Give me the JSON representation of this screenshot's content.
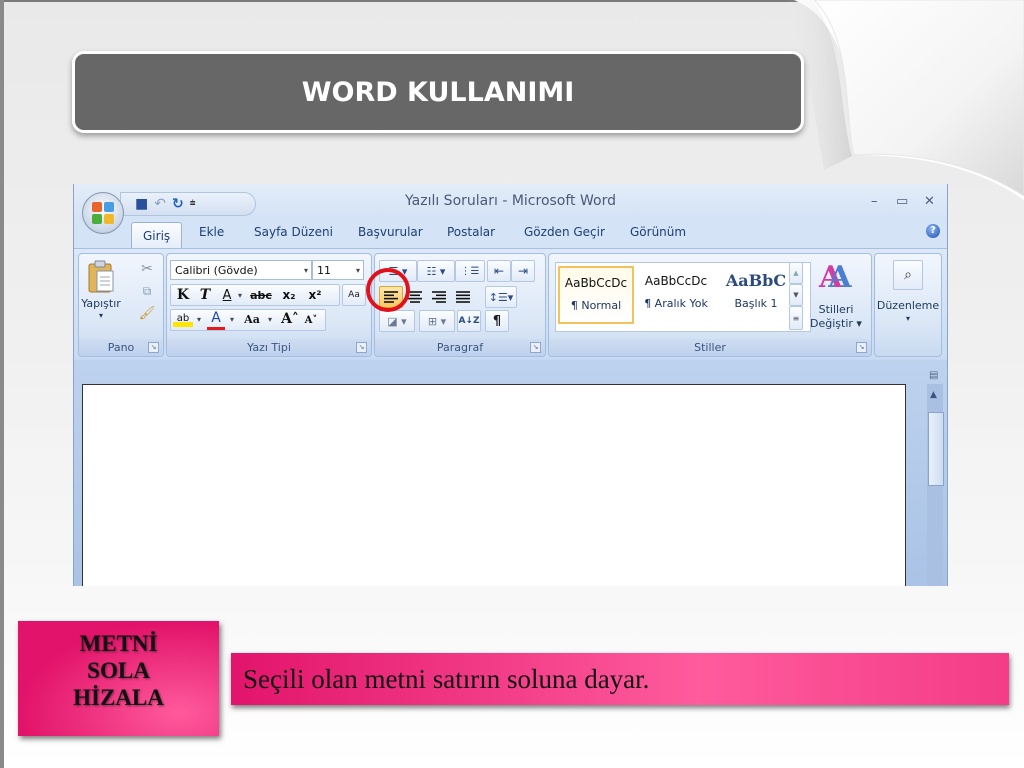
{
  "slide": {
    "title": "WORD KULLANIMI",
    "caption_label": [
      "METNİ",
      "SOLA",
      "HİZALA"
    ],
    "caption_text": "Seçili olan metni satırın soluna dayar."
  },
  "word": {
    "window_title": "Yazılı Soruları - Microsoft Word",
    "window_controls": {
      "minimize": "–",
      "maximize": "▭",
      "close": "✕"
    },
    "qat": {
      "save": "💾",
      "undo": "↶",
      "redo": "↻",
      "customize": "⩧"
    },
    "tabs": [
      {
        "label": "Giriş",
        "active": true
      },
      {
        "label": "Ekle"
      },
      {
        "label": "Sayfa Düzeni"
      },
      {
        "label": "Başvurular"
      },
      {
        "label": "Postalar"
      },
      {
        "label": "Gözden Geçir"
      },
      {
        "label": "Görünüm"
      }
    ],
    "help": "?",
    "groups": {
      "pano": {
        "label": "Pano",
        "paste_label": "Yapıştır",
        "paste_arrow": "▾"
      },
      "yazi_tipi": {
        "label": "Yazı Tipi",
        "font_name": "Calibri (Gövde)",
        "font_size": "11",
        "bold": "K",
        "italic": "T",
        "underline": "A",
        "strikethrough": "abc",
        "subscript": "x₂",
        "superscript": "x²",
        "clear_format": "Aa",
        "highlight": "ab",
        "font_color": "A",
        "change_case": "Aa",
        "grow_font": "A˄",
        "shrink_font": "A˅"
      },
      "paragraf": {
        "label": "Paragraf",
        "sort": "A↓Z",
        "show_marks": "¶",
        "selected_button": "align-left"
      },
      "stiller": {
        "label": "Stiller",
        "styles": [
          {
            "sample": "AaBbCcDc",
            "name": "¶ Normal",
            "selected": true
          },
          {
            "sample": "AaBbCcDc",
            "name": "¶ Aralık Yok"
          },
          {
            "sample": "AaBbC",
            "name": "Başlık 1"
          }
        ],
        "change_styles_label_1": "Stilleri",
        "change_styles_label_2": "Değiştir ▾"
      },
      "duzenleme": {
        "label": "Düzenleme",
        "arrow": "▾"
      }
    }
  },
  "colors": {
    "banner_bg": "#676767",
    "caption_pink": "#e2136a",
    "highlight_circle": "#e0111b",
    "selected_button": "#fcd77a"
  }
}
